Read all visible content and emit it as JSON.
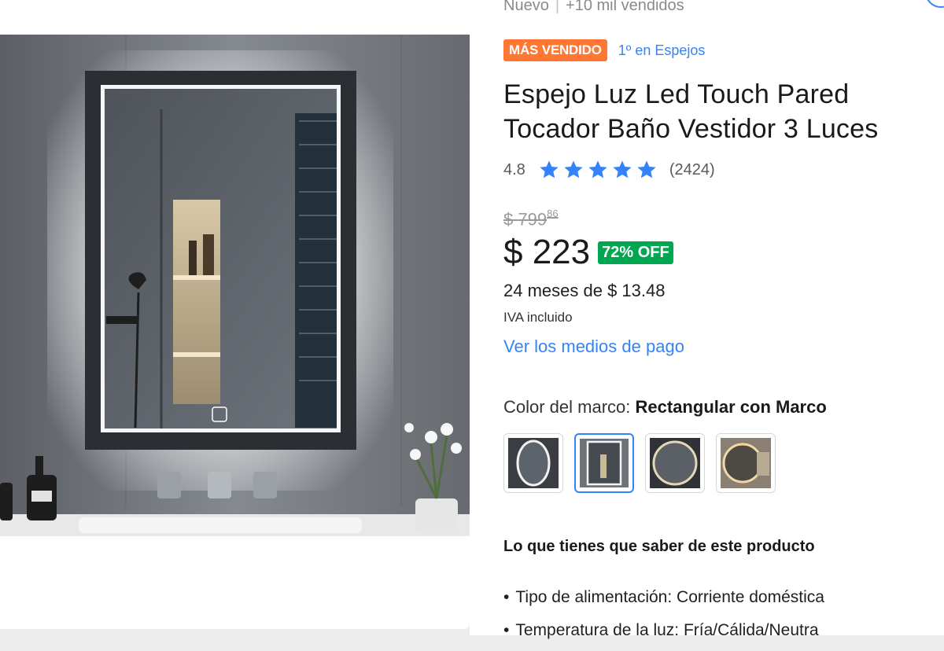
{
  "header": {
    "condition": "Nuevo",
    "sold": "+10 mil vendidos"
  },
  "badges": {
    "best_seller": "MÁS VENDIDO",
    "ranking": "1º en Espejos"
  },
  "product": {
    "title": "Espejo Luz Led Touch Pared Tocador Baño Vestidor 3 Luces"
  },
  "rating": {
    "score": "4.8",
    "stars": 4.8,
    "max_stars": 5,
    "count": "(2424)"
  },
  "price": {
    "original_symbol": "$",
    "original_integer": "799",
    "original_cents": "86",
    "current": "$ 223",
    "discount": "72% OFF",
    "installments": "24 meses de $ 13.48",
    "tax_note": "IVA incluido",
    "payment_link": "Ver los medios de pago"
  },
  "variants": {
    "label": "Color del marco:",
    "selected": "Rectangular con Marco",
    "options": [
      "oval-led",
      "rectangular-marco",
      "round-dark",
      "round-gold"
    ],
    "selected_index": 1
  },
  "details": {
    "title": "Lo que tienes que saber de este producto",
    "items": [
      "Tipo de alimentación: Corriente doméstica",
      "Temperatura de la luz: Fría/Cálida/Neutra"
    ]
  },
  "colors": {
    "accent": "#3483fa",
    "best_seller_bg": "#ff7733",
    "discount_bg": "#00a650"
  }
}
